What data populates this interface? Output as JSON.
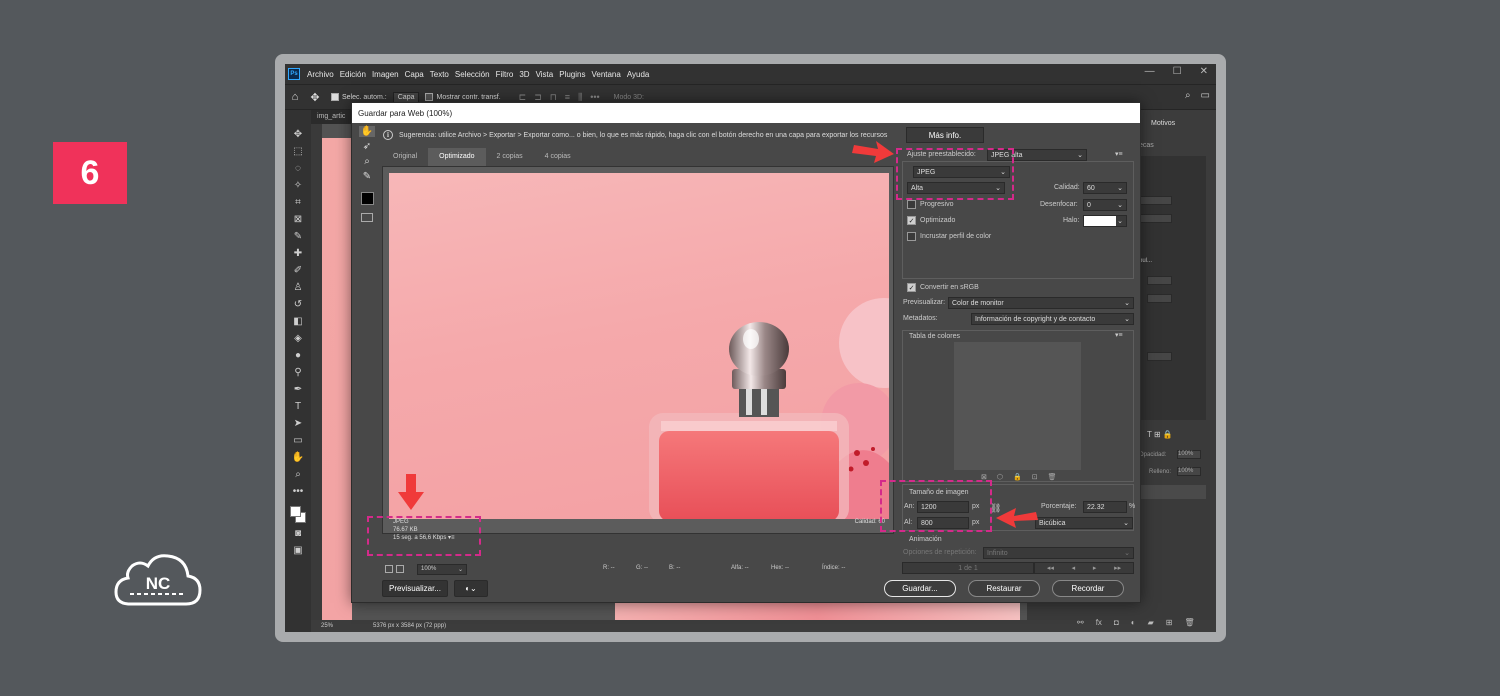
{
  "step_badge": "6",
  "logo_text": "NC",
  "menu": {
    "items": [
      "Archivo",
      "Edición",
      "Imagen",
      "Capa",
      "Texto",
      "Selección",
      "Filtro",
      "3D",
      "Vista",
      "Plugins",
      "Ventana",
      "Ayuda"
    ],
    "window_controls": [
      "—",
      "☐",
      "✕"
    ]
  },
  "options_bar": {
    "auto_select_label": "Selec. autom.:",
    "layer_select": "Capa",
    "transform_label": "Mostrar contr. transf.",
    "mode_3d": "Modo 3D:"
  },
  "doc_tab": "img_artic",
  "status_bar": {
    "zoom": "25%",
    "doc_info": "5376 px x 3584 px (72 ppp)"
  },
  "right_panel": {
    "motivos_tab": "Motivos",
    "frag_label": "ecas",
    "pul_label": "pul...",
    "opacidad_label": "Opacidad:",
    "opacidad_value": "100%",
    "relleno_label": "Relleno:",
    "relleno_value": "100%"
  },
  "dialog": {
    "title": "Guardar para Web (100%)",
    "hint": "Sugerencia: utilice Archivo > Exportar > Exportar como... o bien, lo que es más rápido, haga clic con el botón derecho en una capa para exportar los recursos",
    "more_info": "Más info.",
    "view_tabs": [
      "Original",
      "Optimizado",
      "2 copias",
      "4 copias"
    ],
    "active_tab": "Optimizado",
    "preview_info": {
      "format": "JPEG",
      "size": "76.67 KB",
      "time": "15 seg. a 56,6 Kbps"
    },
    "preview_quality": "Calidad: 60",
    "zoom": "100%",
    "readouts": {
      "r": "R: --",
      "g": "G: --",
      "b": "B: --",
      "alpha": "Alfa: --",
      "hex": "Hex: --",
      "index": "Índice: --"
    },
    "buttons": {
      "preview": "Previsualizar...",
      "save": "Guardar...",
      "reset": "Restaurar",
      "remember": "Recordar"
    },
    "settings": {
      "preset_label": "Ajuste preestablecido:",
      "preset_value": "JPEG alta",
      "format": "JPEG",
      "compression": "Alta",
      "quality_label": "Calidad:",
      "quality_value": "60",
      "progressive_label": "Progresivo",
      "progressive_checked": false,
      "blur_label": "Desenfocar:",
      "blur_value": "0",
      "optimized_label": "Optimizado",
      "optimized_checked": true,
      "matte_label": "Halo:",
      "embed_profile_label": "Incrustar perfil de color",
      "embed_profile_checked": false,
      "convert_srgb_label": "Convertir en sRGB",
      "convert_srgb_checked": true,
      "preview_label": "Previsualizar:",
      "preview_value": "Color de monitor",
      "metadata_label": "Metadatos:",
      "metadata_value": "Información de copyright y de contacto",
      "color_table_label": "Tabla de colores",
      "image_size_label": "Tamaño de imagen",
      "width_label": "An:",
      "width_value": "1200",
      "height_label": "Al:",
      "height_value": "800",
      "unit": "px",
      "percent_label": "Porcentaje:",
      "percent_value": "22.32",
      "percent_unit": "%",
      "quality_method": "Bicúbica",
      "animation_label": "Animación",
      "loop_label": "Opciones de repetición:",
      "loop_value": "Infinito",
      "frame_counter": "1 de 1"
    }
  },
  "colors": {
    "highlight": "#d42a8a",
    "arrow": "#f03a3a",
    "badge": "#f0325a"
  }
}
